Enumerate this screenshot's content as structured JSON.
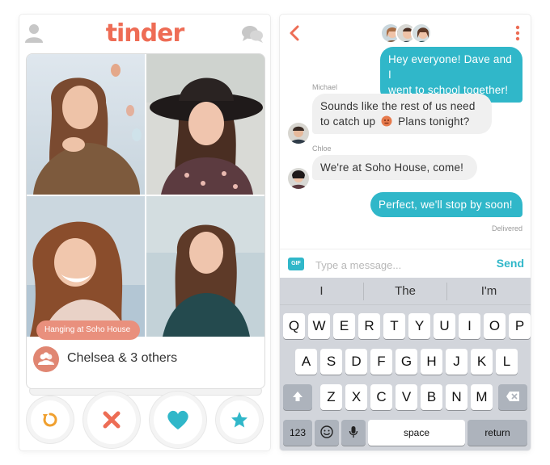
{
  "colors": {
    "brand": "#ee6c55",
    "accent": "#30b7c9",
    "bubble_in": "#f0f0f0",
    "keyboard": "#d2d5db"
  },
  "left": {
    "logo": "tinder",
    "icons": {
      "profile": "profile-icon",
      "messages": "chat-bubbles-icon"
    },
    "card": {
      "hangout_label": "Hanging at Soho House",
      "group_name": "Chelsea & 3 others",
      "group_icon": "group-icon"
    },
    "actions": [
      {
        "name": "rewind-button",
        "icon": "rewind-icon"
      },
      {
        "name": "nope-button",
        "icon": "x-icon"
      },
      {
        "name": "like-button",
        "icon": "heart-icon"
      },
      {
        "name": "super-like-button",
        "icon": "star-icon"
      }
    ]
  },
  "right": {
    "messages": [
      {
        "direction": "out",
        "text_lines": [
          "Hey everyone! Dave and I",
          "went to school together!"
        ]
      },
      {
        "direction": "in",
        "sender": "Michael",
        "text_lines": [
          "Sounds like the rest of us need",
          "to catch up",
          "Plans tonight?"
        ]
      },
      {
        "direction": "in",
        "sender": "Chloe",
        "text_lines": [
          "We're at Soho House, come!"
        ]
      },
      {
        "direction": "out",
        "text_lines": [
          "Perfect, we'll stop by soon!"
        ],
        "status": "Delivered"
      }
    ],
    "compose": {
      "gif_label": "GIF",
      "placeholder": "Type a message...",
      "send_label": "Send"
    },
    "keyboard": {
      "suggestions": [
        "I",
        "The",
        "I'm"
      ],
      "row1": [
        "Q",
        "W",
        "E",
        "R",
        "T",
        "Y",
        "U",
        "I",
        "O",
        "P"
      ],
      "row2": [
        "A",
        "S",
        "D",
        "F",
        "G",
        "H",
        "J",
        "K",
        "L"
      ],
      "row3": [
        "Z",
        "X",
        "C",
        "V",
        "B",
        "N",
        "M"
      ],
      "numbers_label": "123",
      "space_label": "space",
      "return_label": "return"
    }
  }
}
